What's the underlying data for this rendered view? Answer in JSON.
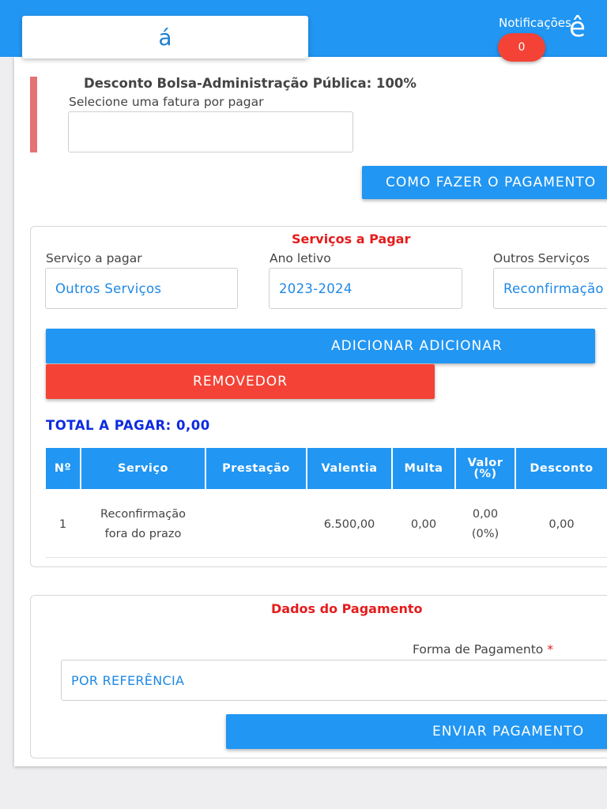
{
  "header": {
    "search_glyph": "á",
    "notifications_label": "Notificações",
    "notifications_count": "0",
    "user_glyph": "ê"
  },
  "discount": {
    "title": "Desconto Bolsa-Administração Pública: 100%",
    "select_label": "Selecione uma fatura por pagar",
    "invoice_value": ""
  },
  "how_to_pay_label": "COMO FAZER O PAGAMENTO",
  "services": {
    "title": "Serviços a Pagar",
    "service_label": "Serviço a pagar",
    "service_value": "Outros Serviços",
    "year_label": "Ano letivo",
    "year_value": "2023-2024",
    "other_label": "Outros Serviços",
    "other_value": "Reconfirmação fora do prazo",
    "add_label": "ADICIONAR ADICIONAR",
    "remove_label": "REMOVEDOR",
    "total_label": "TOTAL A PAGAR: 0,00"
  },
  "table": {
    "headers": [
      "Nº",
      "Serviço",
      "Prestação",
      "Valentia",
      "Multa",
      "Valor (%)",
      "Desconto"
    ],
    "rows": [
      {
        "num": "1",
        "service_line1": "Reconfirmação",
        "service_line2": "fora do prazo",
        "installment": "",
        "value": "6.500,00",
        "fine": "0,00",
        "pct_line1": "0,00",
        "pct_line2": "(0%)",
        "discount": "0,00"
      }
    ]
  },
  "payment": {
    "title": "Dados do Pagamento",
    "method_label": "Forma de Pagamento",
    "required_mark": "*",
    "method_value": "POR REFERÊNCIA",
    "send_label": "ENVIAR PAGAMENTO"
  },
  "colors": {
    "primary": "#2196f3",
    "danger": "#f44336",
    "title_red": "#e51c1c",
    "total_blue": "#0d2be0"
  }
}
